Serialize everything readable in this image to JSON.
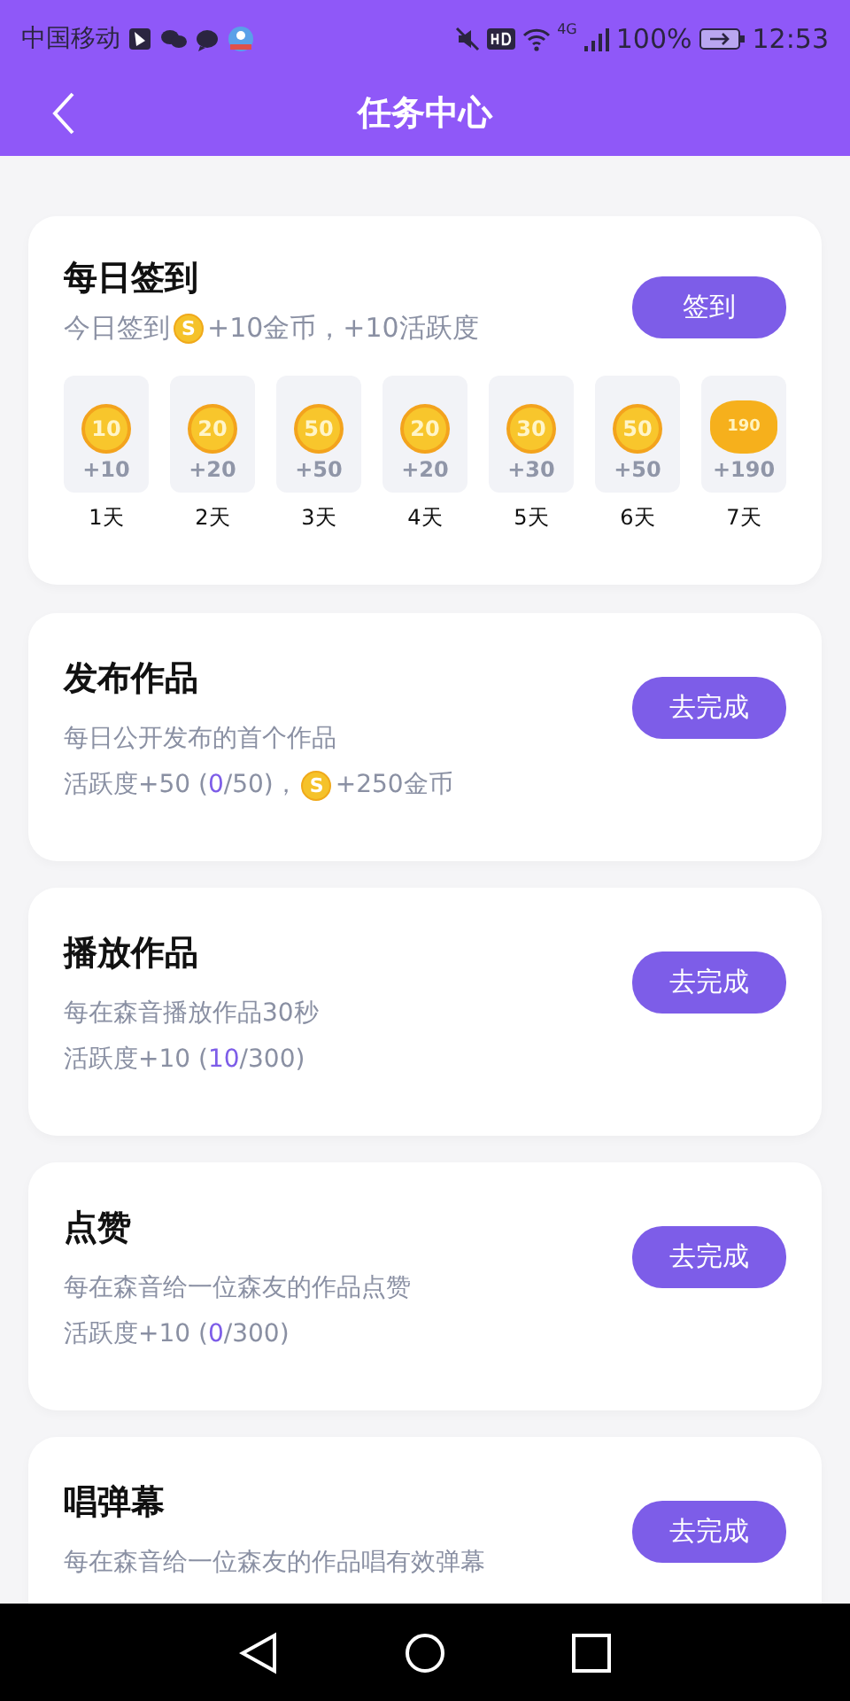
{
  "status_bar": {
    "carrier": "中国移动",
    "network": "4G",
    "battery": "100%",
    "time": "12:53"
  },
  "header": {
    "title": "任务中心"
  },
  "sign_in": {
    "title": "每日签到",
    "button": "签到",
    "subtitle": [
      {
        "kind": "text",
        "text": "今日签到"
      },
      {
        "kind": "coin",
        "symbol": "S"
      },
      {
        "kind": "text",
        "text": "+10金币，+10活跃度"
      }
    ],
    "days": [
      {
        "kind": "coin",
        "coin": "10",
        "reward": "+10",
        "label": "1天"
      },
      {
        "kind": "coin",
        "coin": "20",
        "reward": "+20",
        "label": "2天"
      },
      {
        "kind": "coin",
        "coin": "50",
        "reward": "+50",
        "label": "3天"
      },
      {
        "kind": "coin",
        "coin": "20",
        "reward": "+20",
        "label": "4天"
      },
      {
        "kind": "coin",
        "coin": "30",
        "reward": "+30",
        "label": "5天"
      },
      {
        "kind": "coin",
        "coin": "50",
        "reward": "+50",
        "label": "6天"
      },
      {
        "kind": "bag",
        "coin": "190",
        "reward": "+190",
        "label": "7天"
      }
    ]
  },
  "tasks": [
    {
      "title": "发布作品",
      "description": "每日公开发布的首个作品",
      "button": "去完成",
      "progress": [
        {
          "kind": "text",
          "text": "活跃度+50 ("
        },
        {
          "kind": "highlight",
          "text": "0"
        },
        {
          "kind": "text",
          "text": "/50)，"
        },
        {
          "kind": "coin",
          "symbol": "S"
        },
        {
          "kind": "text",
          "text": "+250金币"
        }
      ]
    },
    {
      "title": "播放作品",
      "description": "每在森音播放作品30秒",
      "button": "去完成",
      "progress": [
        {
          "kind": "text",
          "text": "活跃度+10 ("
        },
        {
          "kind": "highlight",
          "text": "10"
        },
        {
          "kind": "text",
          "text": "/300)"
        }
      ]
    },
    {
      "title": "点赞",
      "description": "每在森音给一位森友的作品点赞",
      "button": "去完成",
      "progress": [
        {
          "kind": "text",
          "text": "活跃度+10 ("
        },
        {
          "kind": "highlight",
          "text": "0"
        },
        {
          "kind": "text",
          "text": "/300)"
        }
      ]
    },
    {
      "title": "唱弹幕",
      "description": "每在森音给一位森友的作品唱有效弹幕",
      "button": "去完成"
    }
  ]
}
